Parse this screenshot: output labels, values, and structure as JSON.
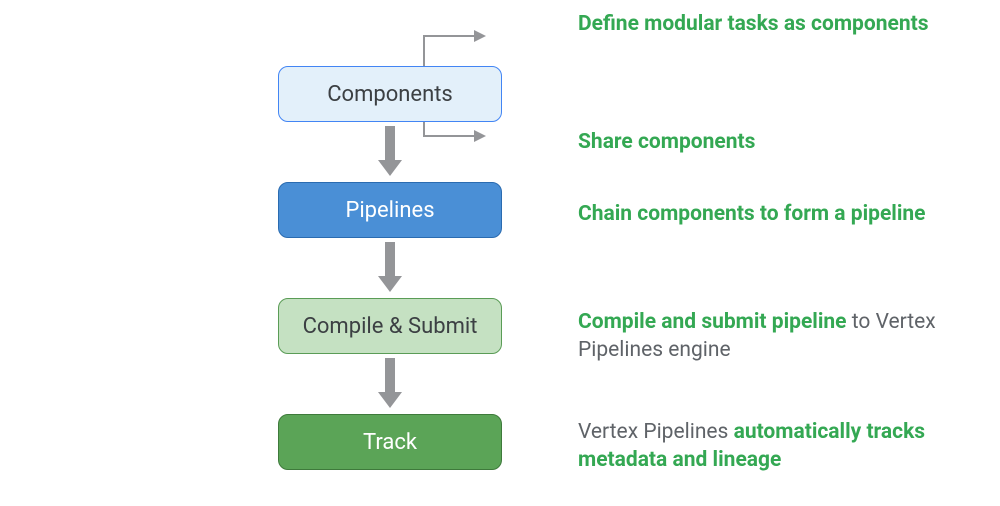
{
  "boxes": {
    "components": "Components",
    "pipelines": "Pipelines",
    "compile": "Compile & Submit",
    "track": "Track"
  },
  "labels": {
    "row0": {
      "green": "Define modular tasks as components"
    },
    "row1": {
      "green": "Share components"
    },
    "row2": {
      "green": "Chain components to form a pipeline"
    },
    "row3": {
      "green": "Compile and submit pipeline",
      "gray": " to Vertex Pipelines engine"
    },
    "row4": {
      "gray_pre": "Vertex Pipelines ",
      "green": "automatically tracks metadata and lineage"
    }
  },
  "colors": {
    "arrow": "#949598",
    "green": "#34a853"
  }
}
